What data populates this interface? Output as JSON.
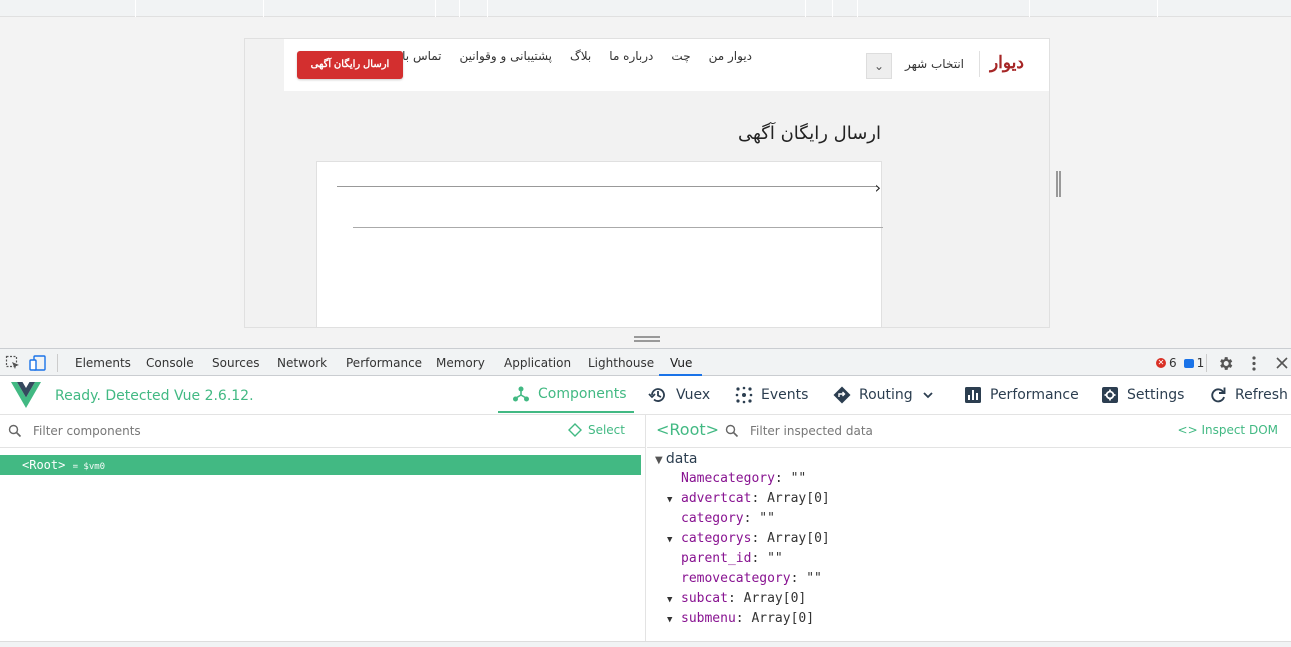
{
  "site": {
    "logo": "دیوار",
    "city_label": "انتخاب شهر",
    "city_chevron": "⌄",
    "nav": [
      "دیوار من",
      "چت",
      "درباره ما",
      "بلاگ",
      "پشتیبانی و وقوانین",
      "تماس با ما"
    ],
    "post_button": "ارسال رایگان آگهی",
    "page_title": "ارسال رایگان آگهی",
    "form_arrow": "›"
  },
  "devtools": {
    "tabs": [
      "Elements",
      "Console",
      "Sources",
      "Network",
      "Performance",
      "Memory",
      "Application",
      "Lighthouse",
      "Vue"
    ],
    "active_tab": "Vue",
    "errors": "6",
    "messages": "1"
  },
  "vue": {
    "status": "Ready. Detected Vue 2.6.12.",
    "nav": [
      "Components",
      "Vuex",
      "Events",
      "Routing",
      "Performance",
      "Settings",
      "Refresh"
    ],
    "active_nav": "Components",
    "filter_components_placeholder": "Filter components",
    "select_label": "Select",
    "root_label": "<Root>",
    "root_vm": "= $vm0",
    "root_tag": "<Root>",
    "filter_data_placeholder": "Filter inspected data",
    "inspect_dom": "<> Inspect DOM",
    "data_section": "data",
    "data_rows": [
      {
        "key": "Namecategory",
        "value": "\"\"",
        "expandable": false
      },
      {
        "key": "advertcat",
        "value": "Array[0]",
        "expandable": true
      },
      {
        "key": "category",
        "value": "\"\"",
        "expandable": false
      },
      {
        "key": "categorys",
        "value": "Array[0]",
        "expandable": true
      },
      {
        "key": "parent_id",
        "value": "\"\"",
        "expandable": false
      },
      {
        "key": "removecategory",
        "value": "\"\"",
        "expandable": false
      },
      {
        "key": "subcat",
        "value": "Array[0]",
        "expandable": true
      },
      {
        "key": "submenu",
        "value": "Array[0]",
        "expandable": true
      }
    ]
  },
  "colors": {
    "vue_green": "#42b983",
    "brand_red": "#a62626",
    "button_red": "#d32f2f",
    "devtools_blue": "#1a73e8"
  }
}
